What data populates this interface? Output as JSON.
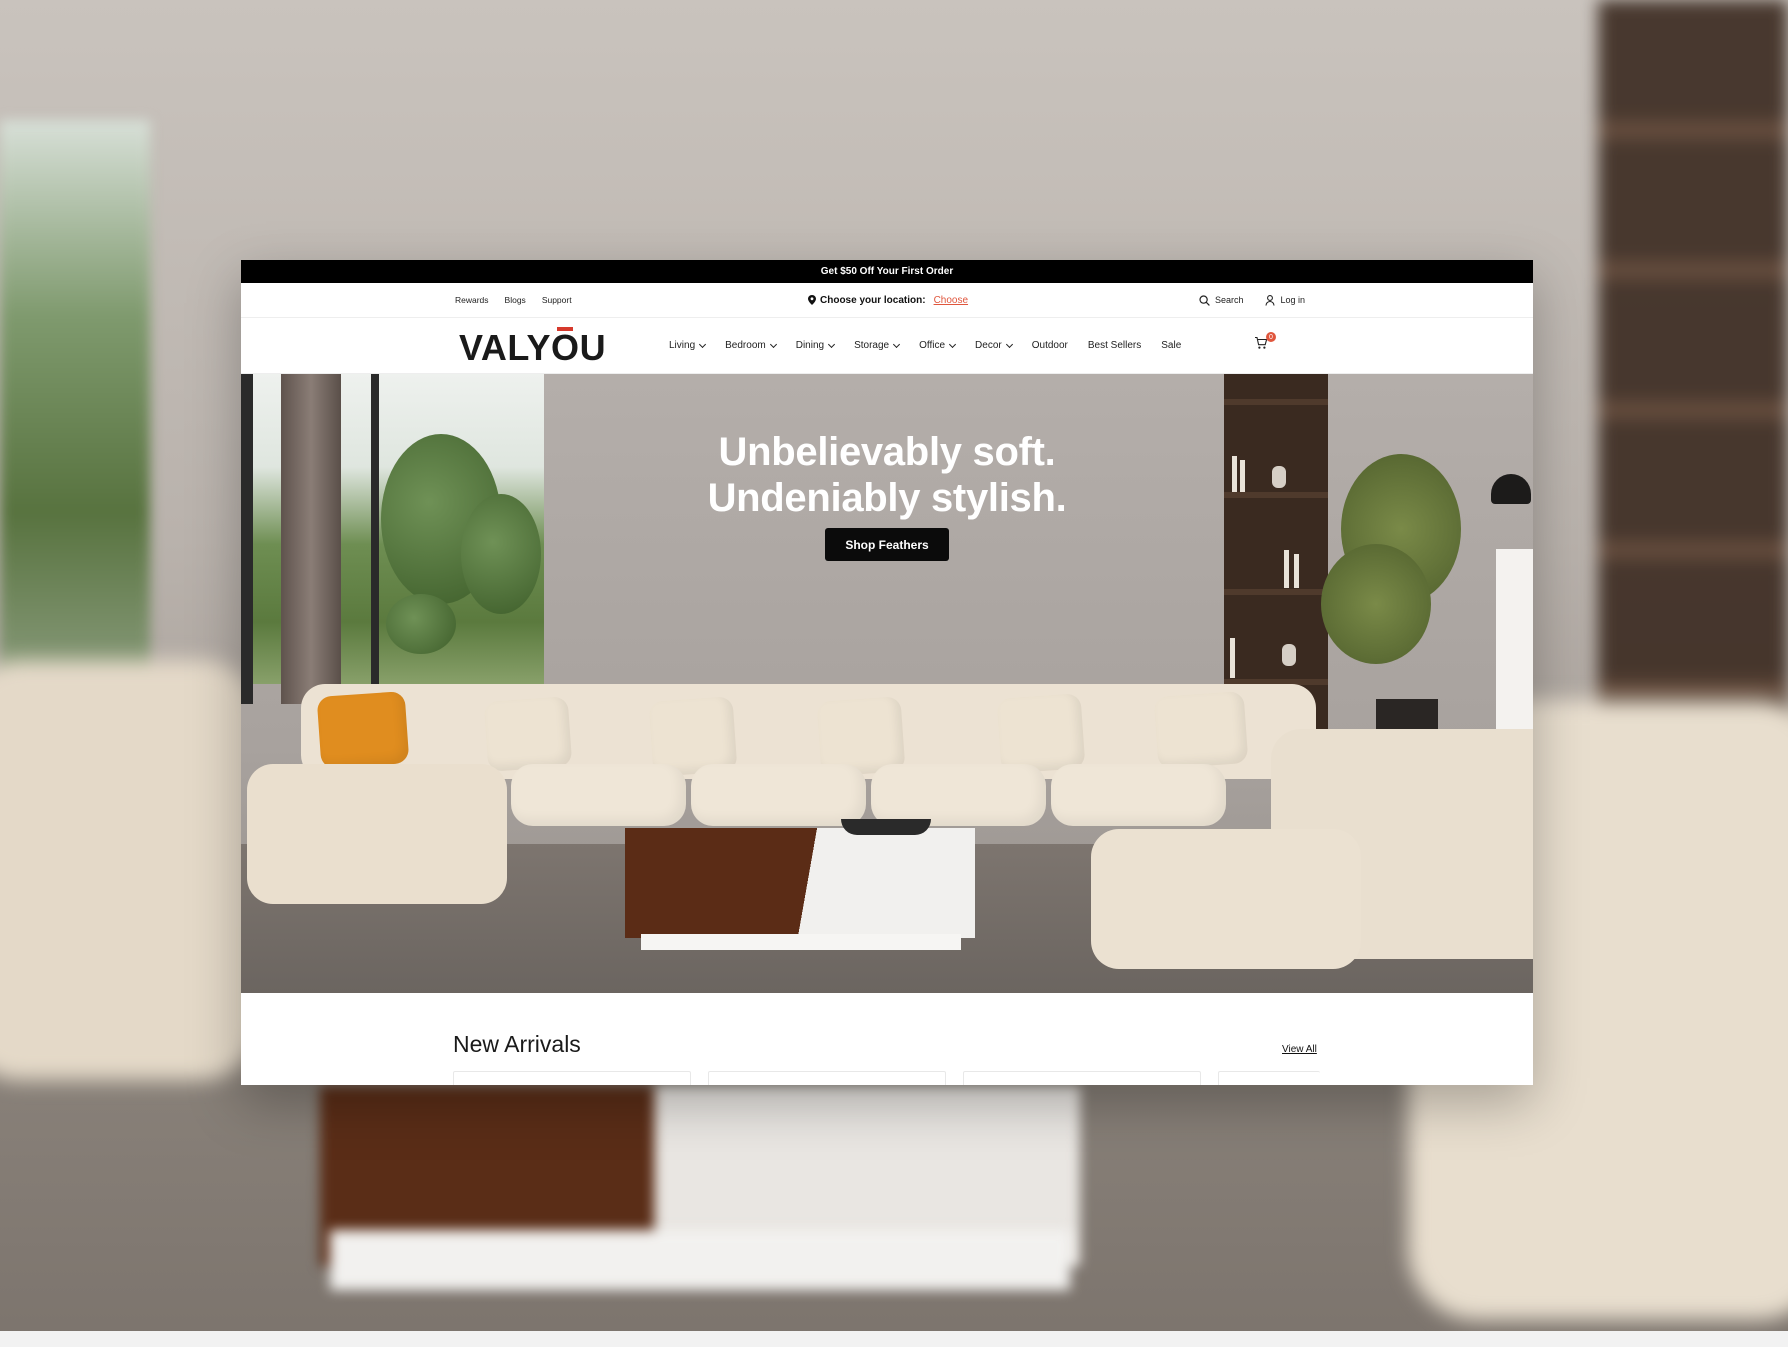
{
  "promo": {
    "text": "Get $50 Off Your First Order"
  },
  "utility": {
    "links": [
      "Rewards",
      "Blogs",
      "Support"
    ],
    "location_label": "Choose your location:",
    "location_action": "Choose",
    "search_label": "Search",
    "login_label": "Log in"
  },
  "nav": {
    "logo": {
      "before": "VALY",
      "accent_letter": "O",
      "after": "U"
    },
    "items": [
      {
        "label": "Living",
        "dropdown": true
      },
      {
        "label": "Bedroom",
        "dropdown": true
      },
      {
        "label": "Dining",
        "dropdown": true
      },
      {
        "label": "Storage",
        "dropdown": true
      },
      {
        "label": "Office",
        "dropdown": true
      },
      {
        "label": "Decor",
        "dropdown": true
      },
      {
        "label": "Outdoor",
        "dropdown": false
      },
      {
        "label": "Best Sellers",
        "dropdown": false
      },
      {
        "label": "Sale",
        "dropdown": false
      }
    ],
    "cart_count": "0"
  },
  "hero": {
    "line1": "Unbelievably soft.",
    "line2": "Undeniably stylish.",
    "cta": "Shop Feathers"
  },
  "arrivals": {
    "title": "New Arrivals",
    "view_all": "View All"
  },
  "colors": {
    "accent": "#e0563d",
    "logo_accent": "#d6392c",
    "promo_bg": "#000000",
    "cta_bg": "#0b0b0b"
  }
}
